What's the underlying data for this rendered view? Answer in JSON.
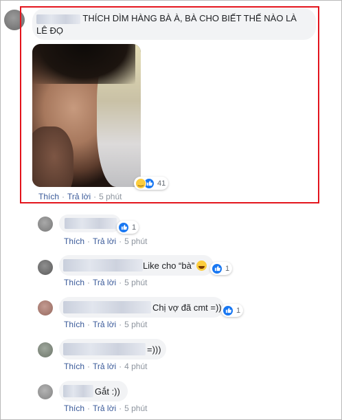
{
  "main_comment": {
    "text_line1": "THÍCH DÌM HÀNG BÀ À, BÀ CHO BIẾT THẾ NÀO LÀ",
    "text_line2": "LÊ ĐỌ",
    "reaction_count": "41",
    "actions": {
      "like": "Thích",
      "reply": "Trả lời",
      "time": "5 phút"
    }
  },
  "replies": [
    {
      "text": "",
      "reaction_count": "1",
      "actions": {
        "like": "Thích",
        "reply": "Trả lời",
        "time": "5 phút"
      }
    },
    {
      "text": "Like cho “bà”",
      "reaction_count": "1",
      "actions": {
        "like": "Thích",
        "reply": "Trả lời",
        "time": "5 phút"
      }
    },
    {
      "text": "Chị vợ đã cmt =))",
      "reaction_count": "1",
      "actions": {
        "like": "Thích",
        "reply": "Trả lời",
        "time": "5 phút"
      }
    },
    {
      "text": "=)))",
      "actions": {
        "like": "Thích",
        "reply": "Trả lời",
        "time": "4 phút"
      }
    },
    {
      "text": "Gắt :))",
      "actions": {
        "like": "Thích",
        "reply": "Trả lời",
        "time": "5 phút"
      }
    }
  ],
  "colors": {
    "highlight_border": "#e3131b",
    "link": "#385898",
    "like_blue": "#1877f2",
    "bubble": "#f2f3f5"
  },
  "icons": [
    "like-icon",
    "haha-icon"
  ]
}
